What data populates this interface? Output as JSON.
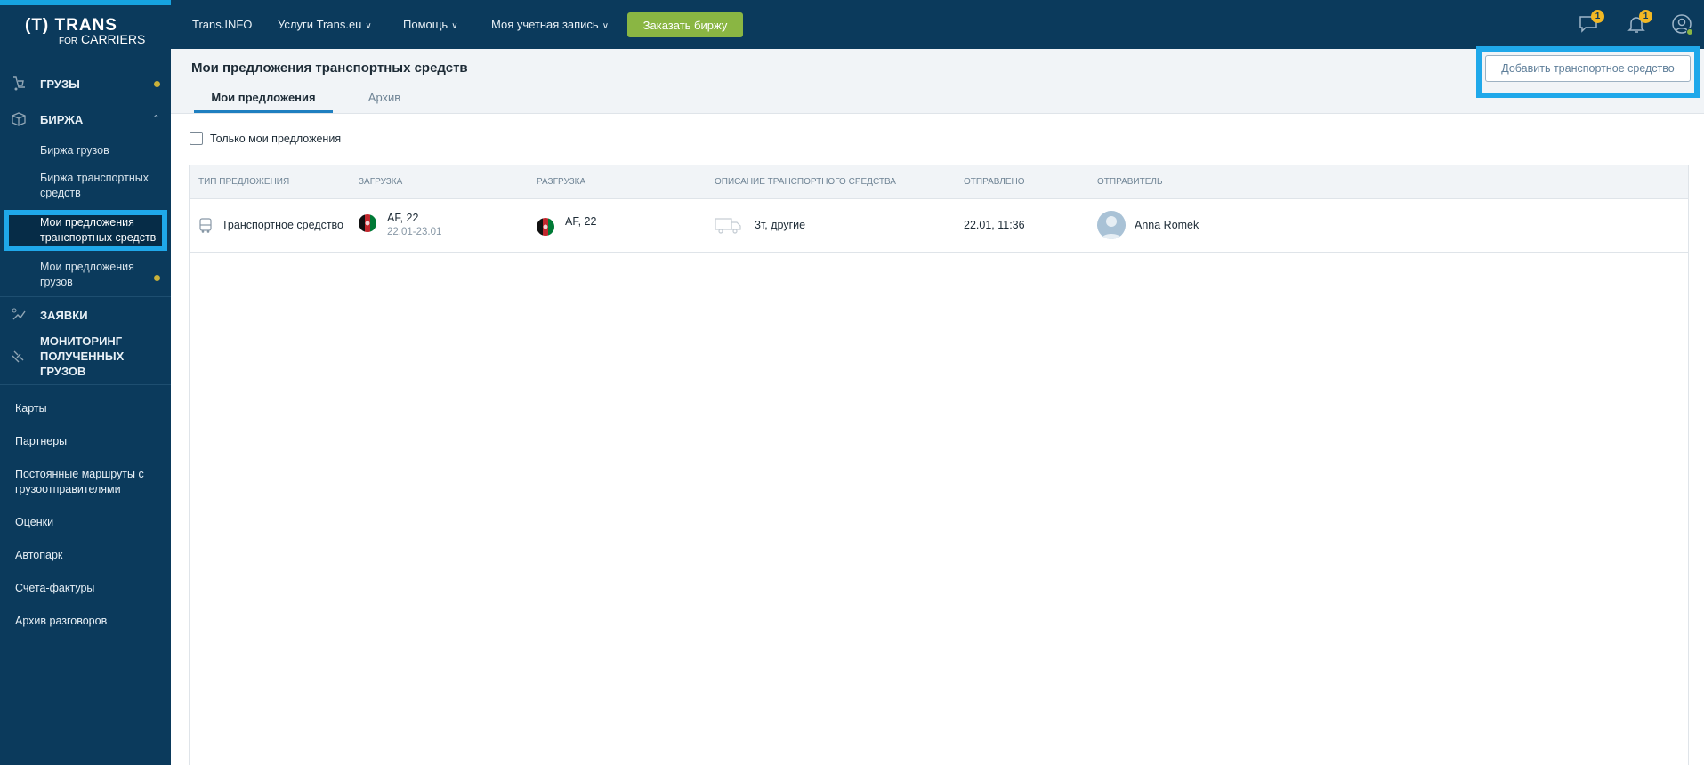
{
  "logo": {
    "trans": "(T) TRANS",
    "for": "FOR",
    "carriers": "CARRIERS"
  },
  "topbar": {
    "links": [
      {
        "label": "Trans.INFO",
        "has_caret": false
      },
      {
        "label": "Услуги Trans.eu",
        "has_caret": true
      },
      {
        "label": "Помощь",
        "has_caret": true
      },
      {
        "label": "Моя учетная запись",
        "has_caret": true
      }
    ],
    "order_button": "Заказать биржу",
    "messages_badge": "1",
    "notifications_badge": "1"
  },
  "sidebar": {
    "sections": [
      {
        "label": "ГРУЗЫ",
        "icon": "cargo-icon",
        "dot": true
      },
      {
        "label": "БИРЖА",
        "icon": "box-icon",
        "expanded": true
      }
    ],
    "sub_items": [
      {
        "label": "Биржа грузов",
        "active": false,
        "dot": false
      },
      {
        "label": "Биржа транспортных средств",
        "active": false,
        "dot": false
      },
      {
        "label": "Мои предложения транспортных средств",
        "active": true,
        "dot": false
      },
      {
        "label": "Мои предложения грузов",
        "active": false,
        "dot": true
      }
    ],
    "sections2": [
      {
        "label": "ЗАЯВКИ",
        "icon": "orders-icon"
      },
      {
        "label": "МОНИТОРИНГ ПОЛУЧЕННЫХ ГРУЗОВ",
        "icon": "satellite-icon"
      }
    ],
    "plain_items": [
      "Карты",
      "Партнеры",
      "Постоянные маршруты с грузоотправителями",
      "Оценки",
      "Автопарк",
      "Счета-фактуры",
      "Архив разговоров"
    ]
  },
  "header": {
    "title": "Мои предложения транспортных средств",
    "tabs": [
      {
        "label": "Мои предложения",
        "active": true
      },
      {
        "label": "Архив",
        "active": false
      }
    ],
    "add_button": "Добавить транспортное средство"
  },
  "filter": {
    "label": "Только мои предложения",
    "checked": false
  },
  "table": {
    "columns": [
      "Тип предложения",
      "Загрузка",
      "Разгрузка",
      "Описание транспортного средства",
      "Отправлено",
      "Отправитель"
    ],
    "rows": [
      {
        "type": "Транспортное средство",
        "loading": "AF, 22",
        "loading_dates": "22.01-23.01",
        "unloading": "AF, 22",
        "vehicle": "3т, другие",
        "sent": "22.01, 11:36",
        "sender": "Anna Romek"
      }
    ]
  },
  "colors": {
    "sidebar": "#0b3a5c",
    "accent": "#1fa8ea",
    "order_button": "#8ab643",
    "badge": "#f2b824"
  }
}
